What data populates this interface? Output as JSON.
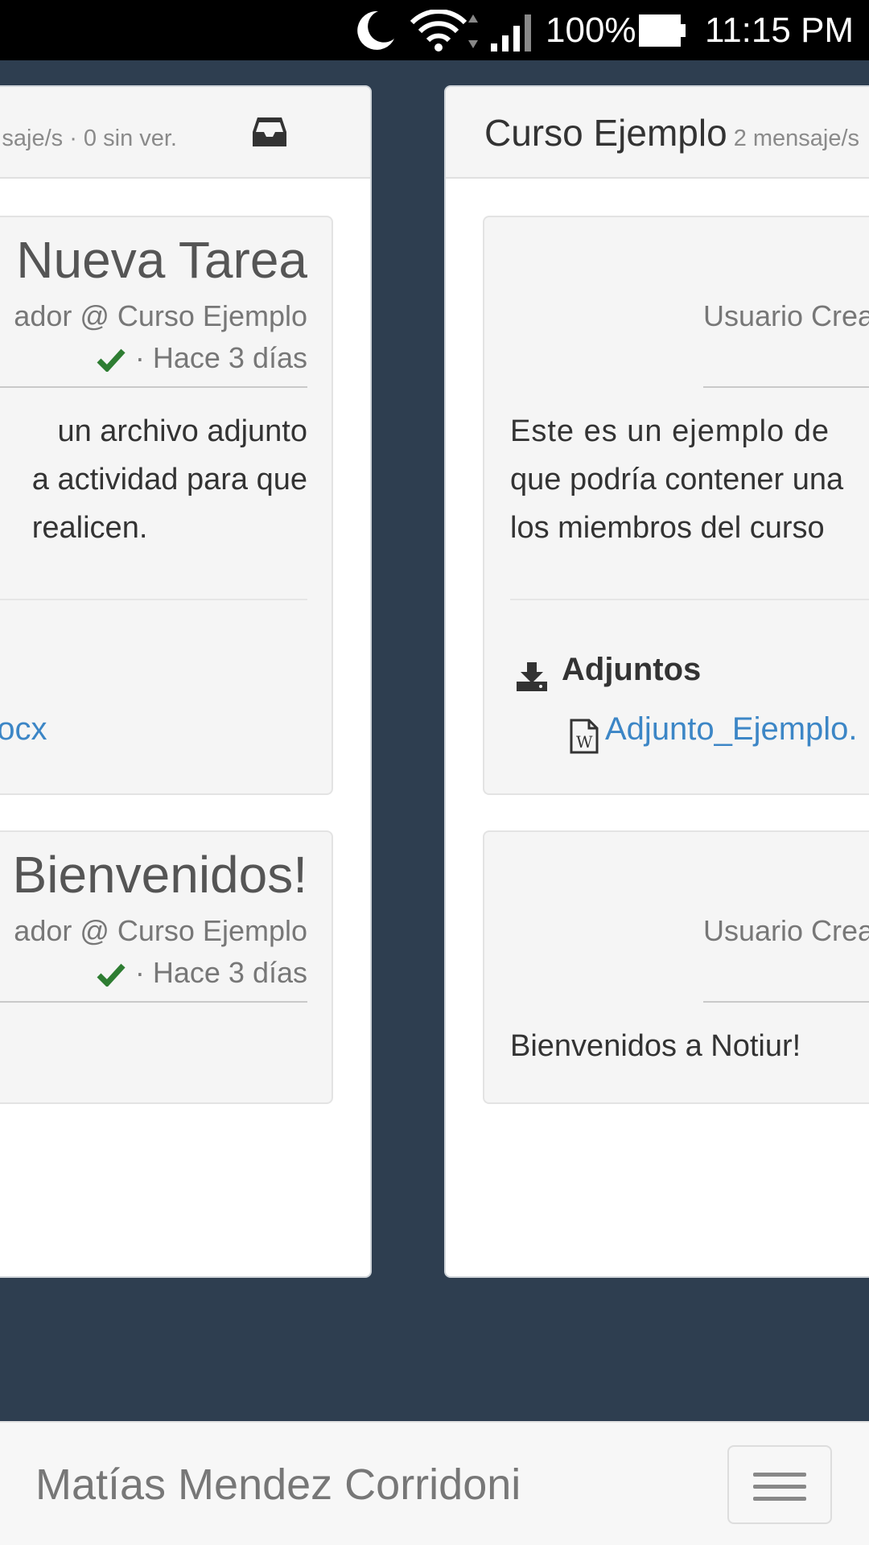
{
  "status_bar": {
    "battery_percent": "100%",
    "time": "11:15 PM",
    "icons": [
      "moon-icon",
      "wifi-icon",
      "signal-icon",
      "battery-icon"
    ]
  },
  "left_column": {
    "header_meta": "saje/s · 0 sin ver.",
    "header_icon": "inbox-icon",
    "cards": [
      {
        "title": "Nueva Tarea",
        "subtitle": "ador @ Curso Ejemplo",
        "time": "· Hace 3 días",
        "body_lines": [
          "un archivo adjunto",
          "a actividad para que",
          "realicen."
        ],
        "attachment_link": "docx"
      },
      {
        "title": "Bienvenidos!",
        "subtitle": "ador @ Curso Ejemplo",
        "time": "· Hace 3 días"
      }
    ]
  },
  "right_column": {
    "title": "Curso Ejemplo",
    "meta": "2 mensaje/s",
    "cards": [
      {
        "author": "Usuario Crea",
        "body_lines": [
          "Este es un ejemplo de",
          "que podría contener una",
          "los miembros del curso"
        ],
        "attachments_title": "Adjuntos",
        "attachment_link": "Adjunto_Ejemplo."
      },
      {
        "author": "Usuario Crea",
        "body": "Bienvenidos a Notiur!"
      }
    ]
  },
  "bottom_nav": {
    "user_name": "Matías Mendez Corridoni",
    "menu_icon": "hamburger-menu-icon"
  },
  "colors": {
    "background": "#2e3e50",
    "link": "#3c86c6",
    "check": "#2e7d32"
  }
}
